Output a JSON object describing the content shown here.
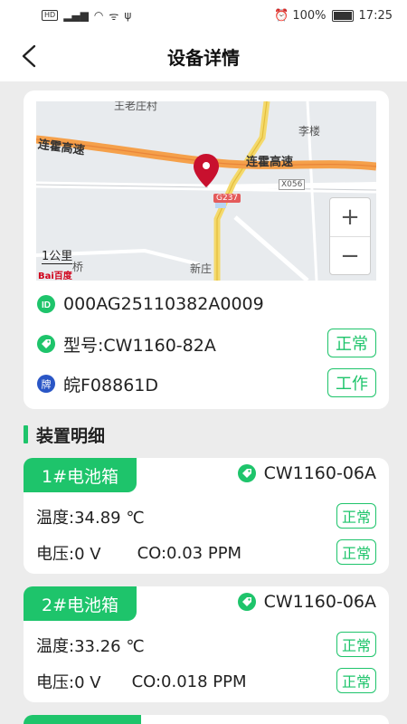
{
  "status_bar": {
    "battery": "100%",
    "time": "17:25"
  },
  "nav": {
    "title": "设备详情"
  },
  "map": {
    "labels": {
      "village_top": "王老庄村",
      "li_lou": "李楼",
      "lianhuo_left": "连霍高速",
      "lianhuo_right": "连霍高速",
      "x056": "X056",
      "g237": "G237",
      "xin_zhuang": "新庄",
      "scale": "1公里",
      "qiao": "桥",
      "baidu": "Bai百度"
    },
    "zoom_in": "+",
    "zoom_out": "−"
  },
  "device": {
    "id": "000AG25110382A0009",
    "model": "型号:CW1160-82A",
    "plate": "皖F08861D",
    "status_normal": "正常",
    "status_work": "工作"
  },
  "section": {
    "title": "装置明细"
  },
  "boxes": [
    {
      "name": "1#电池箱",
      "model": "CW1160-06A",
      "temperature": "温度:34.89 ℃",
      "voltage": "电压:0 V",
      "co": "CO:0.03 PPM",
      "status1": "正常",
      "status2": "正常"
    },
    {
      "name": "2#电池箱",
      "model": "CW1160-06A",
      "temperature": "温度:33.26 ℃",
      "voltage": "电压:0 V",
      "co": "CO:0.018 PPM",
      "status1": "正常",
      "status2": "正常"
    }
  ],
  "colors": {
    "accent": "#1ec46b",
    "map_pin": "#c8102e",
    "plate_icon": "#2a56c6"
  }
}
